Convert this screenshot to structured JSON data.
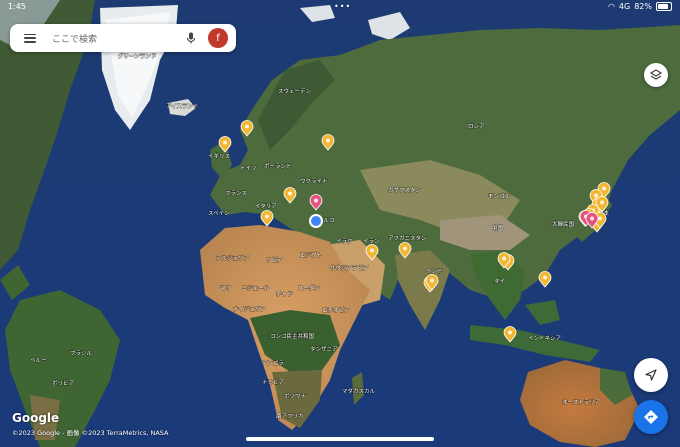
{
  "status_bar": {
    "time": "1:45",
    "signal": "4G",
    "battery": "82%"
  },
  "search": {
    "placeholder": "ここで検索",
    "avatar_letter": "f"
  },
  "map": {
    "labels": [
      {
        "id": "lbl-greenland",
        "text": "グリーンランド"
      },
      {
        "id": "lbl-iceland",
        "text": "アイスランド"
      },
      {
        "id": "lbl-sweden",
        "text": "スウェーデン"
      },
      {
        "id": "lbl-uk",
        "text": "イギリス"
      },
      {
        "id": "lbl-germany",
        "text": "ドイツ"
      },
      {
        "id": "lbl-poland",
        "text": "ポーランド"
      },
      {
        "id": "lbl-ukraine",
        "text": "ウクライナ"
      },
      {
        "id": "lbl-france",
        "text": "フランス"
      },
      {
        "id": "lbl-spain",
        "text": "スペイン"
      },
      {
        "id": "lbl-italy",
        "text": "イタリア"
      },
      {
        "id": "lbl-turkey",
        "text": "トルコ"
      },
      {
        "id": "lbl-russia",
        "text": "ロシア"
      },
      {
        "id": "lbl-kazakhstan",
        "text": "カザフスタン"
      },
      {
        "id": "lbl-mongolia",
        "text": "モンゴル"
      },
      {
        "id": "lbl-china",
        "text": "中国"
      },
      {
        "id": "lbl-japan",
        "text": "日本"
      },
      {
        "id": "lbl-korea",
        "text": "大韓民国"
      },
      {
        "id": "lbl-iran",
        "text": "イラン"
      },
      {
        "id": "lbl-iraq",
        "text": "イラク"
      },
      {
        "id": "lbl-afghanistan",
        "text": "アフガニスタン"
      },
      {
        "id": "lbl-india",
        "text": "インド"
      },
      {
        "id": "lbl-saudi",
        "text": "サウジアラビア"
      },
      {
        "id": "lbl-egypt",
        "text": "エジプト"
      },
      {
        "id": "lbl-libya",
        "text": "リビア"
      },
      {
        "id": "lbl-algeria",
        "text": "アルジェリア"
      },
      {
        "id": "lbl-mali",
        "text": "マリ"
      },
      {
        "id": "lbl-niger",
        "text": "ニジェール"
      },
      {
        "id": "lbl-chad",
        "text": "チャド"
      },
      {
        "id": "lbl-sudan",
        "text": "スーダン"
      },
      {
        "id": "lbl-ethiopia",
        "text": "エチオピア"
      },
      {
        "id": "lbl-nigeria",
        "text": "ナイジェリア"
      },
      {
        "id": "lbl-drc",
        "text": "コンゴ民主共和国"
      },
      {
        "id": "lbl-tanzania",
        "text": "タンザニア"
      },
      {
        "id": "lbl-angola",
        "text": "アンゴラ"
      },
      {
        "id": "lbl-namibia",
        "text": "ナミビア"
      },
      {
        "id": "lbl-botswana",
        "text": "ボツワナ"
      },
      {
        "id": "lbl-southafrica",
        "text": "南アフリカ"
      },
      {
        "id": "lbl-madagascar",
        "text": "マダガスカル"
      },
      {
        "id": "lbl-thailand",
        "text": "タイ"
      },
      {
        "id": "lbl-indonesia",
        "text": "インドネシア"
      },
      {
        "id": "lbl-australia",
        "text": "オーストラリア"
      },
      {
        "id": "lbl-brazil",
        "text": "ブラジル"
      },
      {
        "id": "lbl-peru",
        "text": "ペルー"
      },
      {
        "id": "lbl-bolivia",
        "text": "ボリビア"
      }
    ],
    "pins_yellow": 22,
    "pins_pink": 3,
    "colors": {
      "ocean": "#1e3f78",
      "pin_yellow": "#f2b632",
      "pin_pink": "#e35480",
      "location_dot": "#4285f4",
      "accent": "#1a73e8"
    }
  },
  "footer": {
    "logo": "Google",
    "attribution": "©2023 Google - 画像 ©2023 TerraMetrics, NASA"
  }
}
